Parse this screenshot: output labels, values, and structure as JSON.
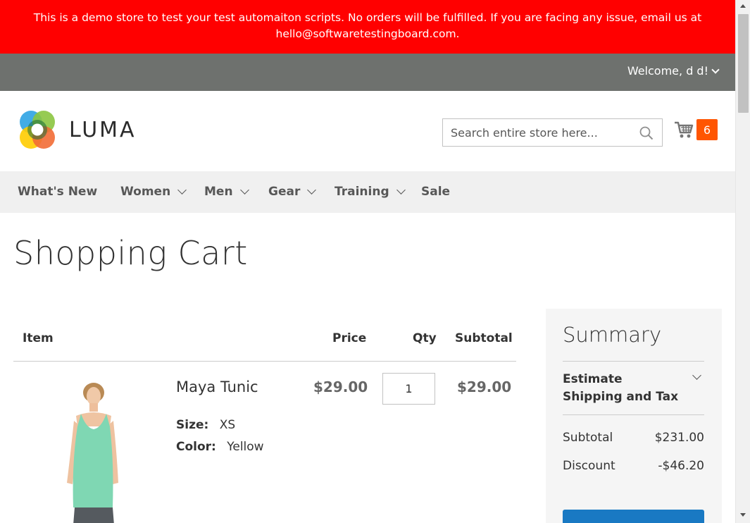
{
  "banner": {
    "text": "This is a demo store to test your test automaiton scripts. No orders will be fulfilled. If you are facing any issue, email us at hello@softwaretestingboard.com."
  },
  "panel": {
    "welcome": "Welcome, d d!"
  },
  "header": {
    "logo_text": "LUMA",
    "search_placeholder": "Search entire store here...",
    "cart_count": "6"
  },
  "nav": {
    "items": [
      {
        "label": "What's New",
        "dropdown": false
      },
      {
        "label": "Women",
        "dropdown": true
      },
      {
        "label": "Men",
        "dropdown": true
      },
      {
        "label": "Gear",
        "dropdown": true
      },
      {
        "label": "Training",
        "dropdown": true
      },
      {
        "label": "Sale",
        "dropdown": false
      }
    ]
  },
  "page": {
    "title": "Shopping Cart"
  },
  "cart": {
    "columns": [
      "Item",
      "Price",
      "Qty",
      "Subtotal"
    ],
    "items": [
      {
        "name": "Maya Tunic",
        "options": [
          {
            "label": "Size:",
            "value": "XS"
          },
          {
            "label": "Color:",
            "value": "Yellow"
          }
        ],
        "price": "$29.00",
        "qty": "1",
        "subtotal": "$29.00"
      }
    ]
  },
  "summary": {
    "title": "Summary",
    "estimate_label": "Estimate Shipping and Tax",
    "rows": [
      {
        "label": "Subtotal",
        "value": "$231.00"
      },
      {
        "label": "Discount",
        "value": "-$46.20"
      }
    ]
  },
  "colors": {
    "banner": "#ff0000",
    "panel": "#6e716e",
    "nav": "#f0f0f0",
    "cart_badge": "#ff5501",
    "checkout_button": "#1979c3"
  }
}
